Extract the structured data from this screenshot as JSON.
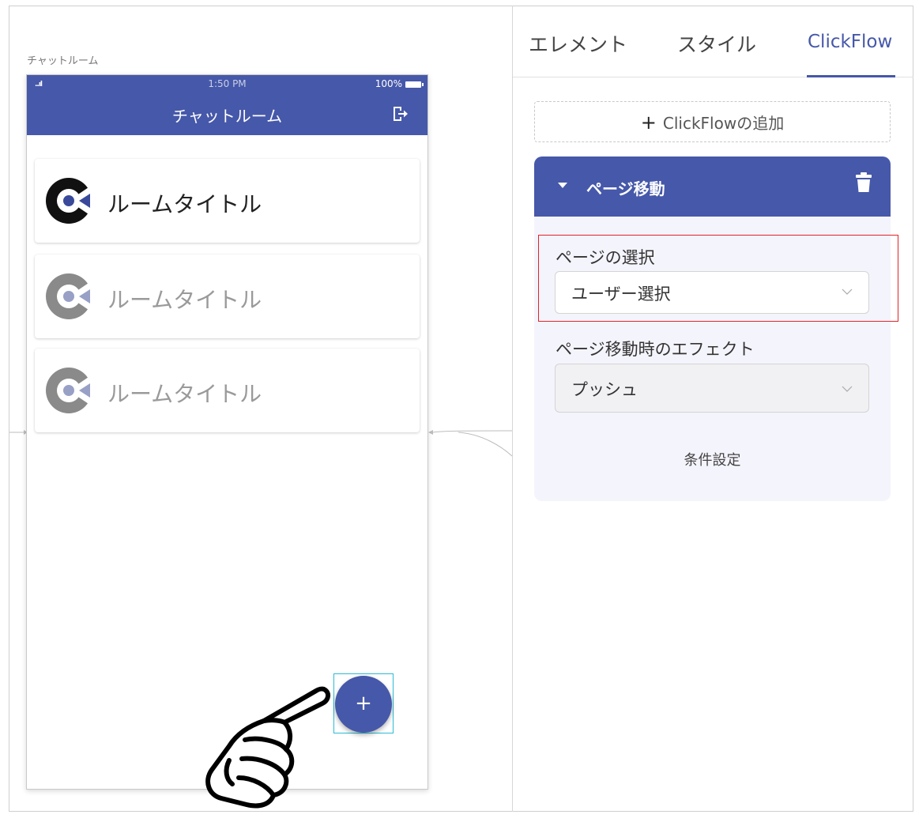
{
  "canvas": {
    "page_label": "チャットルーム",
    "phone": {
      "status": {
        "signal": "..ıl",
        "time": "1:50 PM",
        "battery": "100%"
      },
      "appbar_title": "チャットルーム",
      "rooms": [
        {
          "title": "ルームタイトル",
          "state": "active"
        },
        {
          "title": "ルームタイトル",
          "state": "faded"
        },
        {
          "title": "ルームタイトル",
          "state": "faded"
        }
      ],
      "fab_label": "+"
    }
  },
  "panel": {
    "tabs": [
      {
        "label": "エレメント",
        "active": false
      },
      {
        "label": "スタイル",
        "active": false
      },
      {
        "label": "ClickFlow",
        "active": true
      }
    ],
    "add_flow_plus": "+",
    "add_flow_label": "ClickFlowの追加",
    "flow": {
      "title": "ページ移動",
      "page_select_label": "ページの選択",
      "page_select_value": "ユーザー選択",
      "effect_label": "ページ移動時のエフェクト",
      "effect_value": "プッシュ",
      "condition_link": "条件設定"
    }
  },
  "colors": {
    "accent": "#4658a9",
    "highlight": "#e0242a",
    "selection": "#2bbcd6"
  }
}
